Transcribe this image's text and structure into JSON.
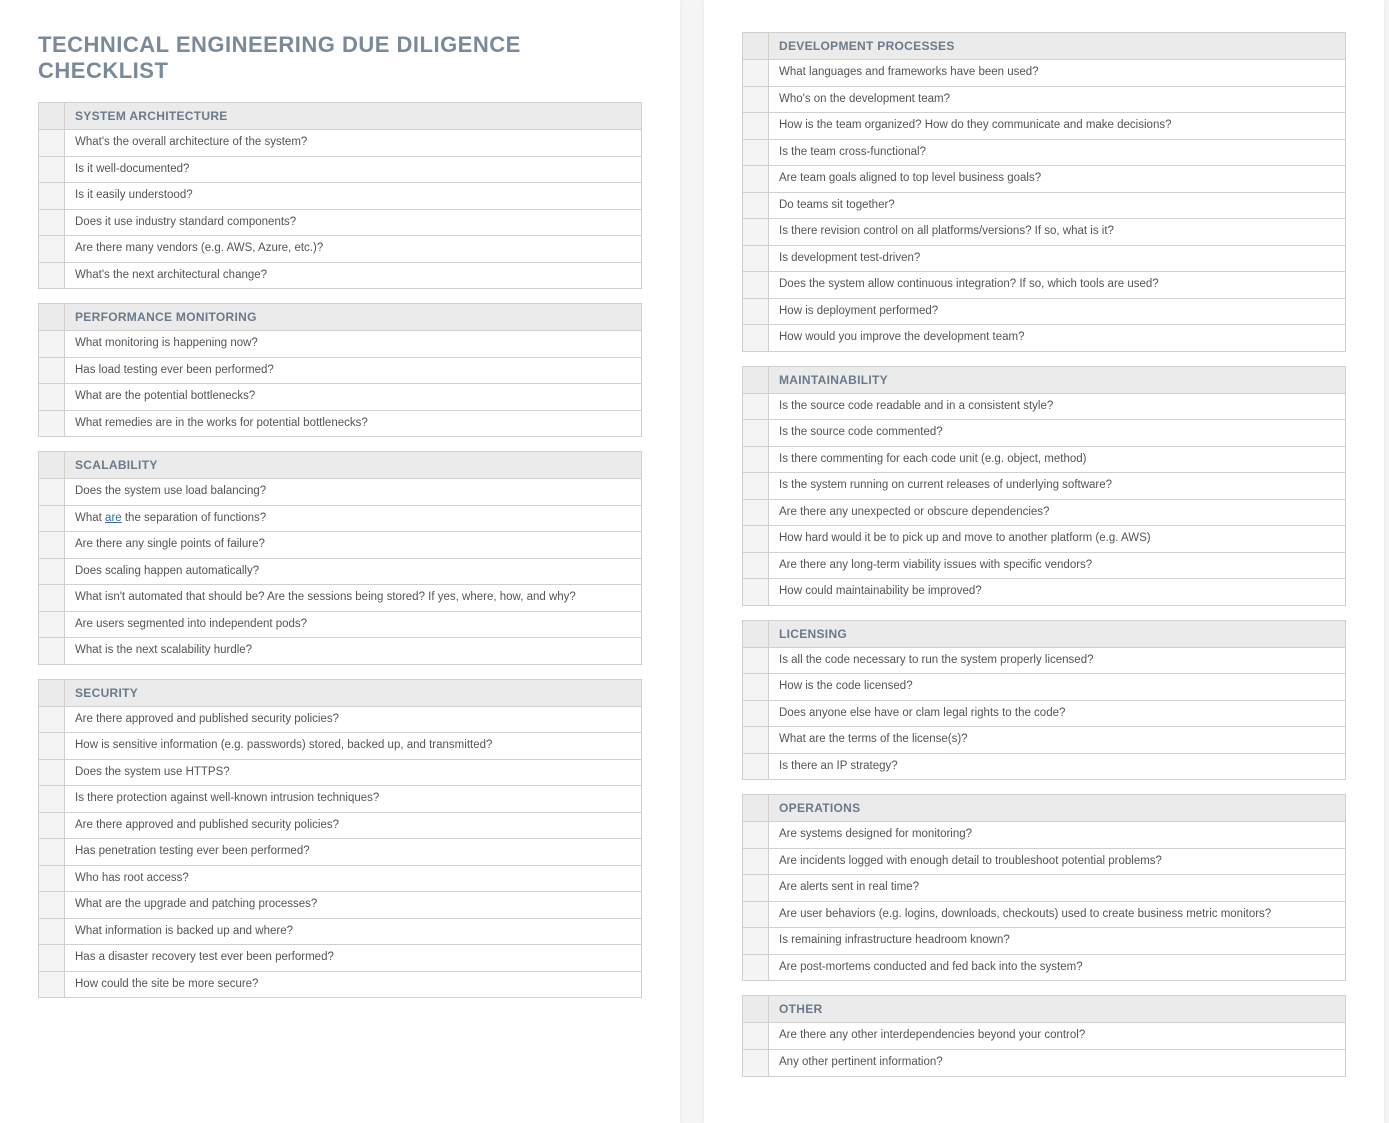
{
  "title": "TECHNICAL ENGINEERING DUE DILIGENCE CHECKLIST",
  "leftSections": [
    {
      "header": "SYSTEM ARCHITECTURE",
      "questions": [
        "What's the overall architecture of the system?",
        "Is it well-documented?",
        "Is it easily understood?",
        "Does it use industry standard components?",
        "Are there many vendors (e.g. AWS, Azure, etc.)?",
        "What's the next architectural change?"
      ]
    },
    {
      "header": "PERFORMANCE MONITORING",
      "questions": [
        "What monitoring is happening now?",
        "Has load testing ever been performed?",
        "What are the potential bottlenecks?",
        "What remedies are in the works for potential bottlenecks?"
      ]
    },
    {
      "header": "SCALABILITY",
      "questions": [
        "Does the system use load balancing?",
        {
          "html": "What <span class='underline'>are</span> the separation of functions?"
        },
        "Are there any single points of failure?",
        "Does scaling happen automatically?",
        "What isn't automated that should be? Are the sessions being stored? If yes, where, how, and why?",
        "Are users segmented into independent pods?",
        "What is the next scalability hurdle?"
      ]
    },
    {
      "header": "SECURITY",
      "questions": [
        "Are there approved and published security policies?",
        "How is sensitive information (e.g. passwords) stored, backed up, and transmitted?",
        "Does the system use HTTPS?",
        "Is there protection against well-known intrusion techniques?",
        "Are there approved and published security policies?",
        "Has penetration testing ever been performed?",
        "Who has root access?",
        "What are the upgrade and patching processes?",
        "What information is backed up and where?",
        "Has a disaster recovery test ever been performed?",
        "How could the site be more secure?"
      ]
    }
  ],
  "rightSections": [
    {
      "header": "DEVELOPMENT PROCESSES",
      "questions": [
        "What languages and frameworks have been used?",
        "Who's on the development team?",
        "How is the team organized? How do they communicate and make decisions?",
        "Is the team cross-functional?",
        "Are team goals aligned to top level business goals?",
        "Do teams sit together?",
        "Is there revision control on all platforms/versions? If so, what is it?",
        "Is development test-driven?",
        "Does the system allow continuous integration? If so, which tools are used?",
        "How is deployment performed?",
        "How would you improve the development team?"
      ]
    },
    {
      "header": "MAINTAINABILITY",
      "questions": [
        "Is the source code readable and in a consistent style?",
        "Is the source code commented?",
        "Is there commenting for each code unit (e.g. object, method)",
        "Is the system running on current releases of underlying software?",
        "Are there any unexpected or obscure dependencies?",
        "How hard would it be to pick up and move to another platform (e.g. AWS)",
        "Are there any long-term viability issues with specific vendors?",
        "How could maintainability be improved?"
      ]
    },
    {
      "header": "LICENSING",
      "questions": [
        "Is all the code necessary to run the system properly licensed?",
        "How is the code licensed?",
        "Does anyone else have or clam legal rights to the code?",
        "What are the terms of the license(s)?",
        "Is there an IP strategy?"
      ]
    },
    {
      "header": "OPERATIONS",
      "questions": [
        "Are systems designed for monitoring?",
        "Are incidents logged with enough detail to troubleshoot potential problems?",
        "Are alerts sent in real time?",
        "Are user behaviors (e.g. logins, downloads, checkouts) used to create business metric monitors?",
        "Is remaining infrastructure headroom known?",
        "Are post-mortems conducted and fed back into the system?"
      ]
    },
    {
      "header": "OTHER",
      "questions": [
        "Are there any other interdependencies beyond your control?",
        "Any other pertinent information?"
      ]
    }
  ]
}
